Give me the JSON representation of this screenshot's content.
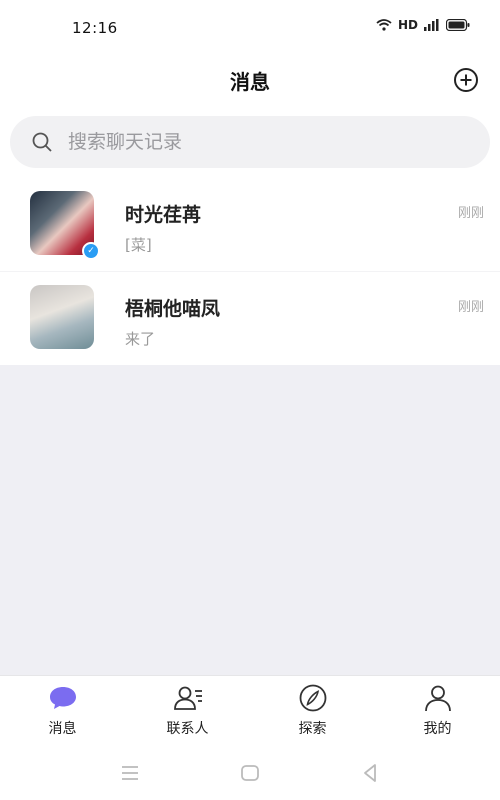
{
  "status_bar": {
    "time": "12:16",
    "network": "HD"
  },
  "header": {
    "title": "消息",
    "add_icon": "plus-circle-icon"
  },
  "search": {
    "placeholder": "搜索聊天记录",
    "value": "",
    "icon": "search-icon"
  },
  "conversations": [
    {
      "name": "时光荏苒",
      "preview": "[菜]",
      "time": "刚刚",
      "has_badge": true
    },
    {
      "name": "梧桐他喵凤",
      "preview": "来了",
      "time": "刚刚",
      "has_badge": false
    }
  ],
  "tabs": [
    {
      "label": "消息",
      "icon": "chat-bubble-icon",
      "active": true,
      "color": "#7b6cf0"
    },
    {
      "label": "联系人",
      "icon": "contacts-icon",
      "active": false
    },
    {
      "label": "探索",
      "icon": "compass-icon",
      "active": false
    },
    {
      "label": "我的",
      "icon": "person-icon",
      "active": false
    }
  ],
  "colors": {
    "accent": "#7b6cf0",
    "badge": "#2a9df4",
    "empty_bg": "#efeff4"
  }
}
